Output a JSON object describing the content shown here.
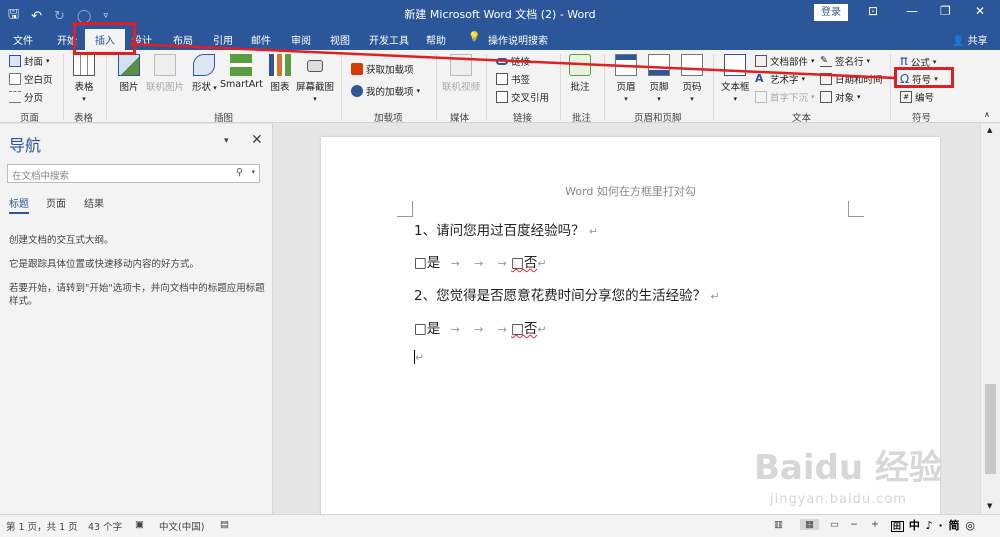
{
  "titlebar": {
    "title": "新建 Microsoft Word 文档 (2) - Word",
    "login": "登录"
  },
  "tabs": {
    "items": [
      "文件",
      "开始",
      "插入",
      "设计",
      "布局",
      "引用",
      "邮件",
      "审阅",
      "视图",
      "开发工具",
      "帮助",
      "操作说明搜索"
    ],
    "share": "共享"
  },
  "ribbon": {
    "page_group": {
      "label": "页面",
      "cover": "封面",
      "blank": "空白页",
      "break": "分页"
    },
    "table_group": {
      "label": "表格",
      "table": "表格"
    },
    "illus_group": {
      "label": "插图",
      "picture": "图片",
      "online_pic": "联机图片",
      "shapes": "形状",
      "smartart": "SmartArt",
      "chart": "图表",
      "screenshot": "屏幕截图"
    },
    "addin_group": {
      "label": "加载项",
      "get": "获取加载项",
      "mine": "我的加载项"
    },
    "media_group": {
      "label": "媒体",
      "video": "联机视频"
    },
    "link_group": {
      "label": "链接",
      "link": "链接",
      "bookmark": "书签",
      "crossref": "交叉引用"
    },
    "comment_group": {
      "label": "批注",
      "comment": "批注"
    },
    "hf_group": {
      "label": "页眉和页脚",
      "header": "页眉",
      "footer": "页脚",
      "pagenum": "页码"
    },
    "text_group": {
      "label": "文本",
      "textbox": "文本框",
      "parts": "文档部件",
      "wordart": "艺术字",
      "dropcap": "首字下沉",
      "sigline": "签名行",
      "datetime": "日期和时间",
      "object": "对象"
    },
    "symbol_group": {
      "label": "符号",
      "equation": "公式",
      "symbol": "符号",
      "number": "编号"
    }
  },
  "nav": {
    "title": "导航",
    "search_placeholder": "在文档中搜索",
    "tabs": [
      "标题",
      "页面",
      "结果"
    ],
    "p1": "创建文档的交互式大纲。",
    "p2": "它是跟踪具体位置或快速移动内容的好方式。",
    "p3": "若要开始，请转到\"开始\"选项卡，并向文档中的标题应用标题样式。"
  },
  "document": {
    "header": "Word 如何在方框里打对勾",
    "q1": "1、请问您用过百度经验吗？",
    "q2": "2、您觉得是否愿意花费时间分享您的生活经验？",
    "opt_yes": "□是",
    "opt_no": "□否",
    "arrow": "→",
    "return_mark": "↵"
  },
  "status": {
    "page": "第 1 页，共 1 页",
    "words": "43 个字",
    "lang": "中文(中国)",
    "ime": "中 ♪ · 简 ◎"
  },
  "watermark": {
    "main": "Baidu 经验",
    "sub": "jingyan.baidu.com"
  },
  "colors": {
    "accent": "#2b579a",
    "highlight": "#e02020"
  }
}
